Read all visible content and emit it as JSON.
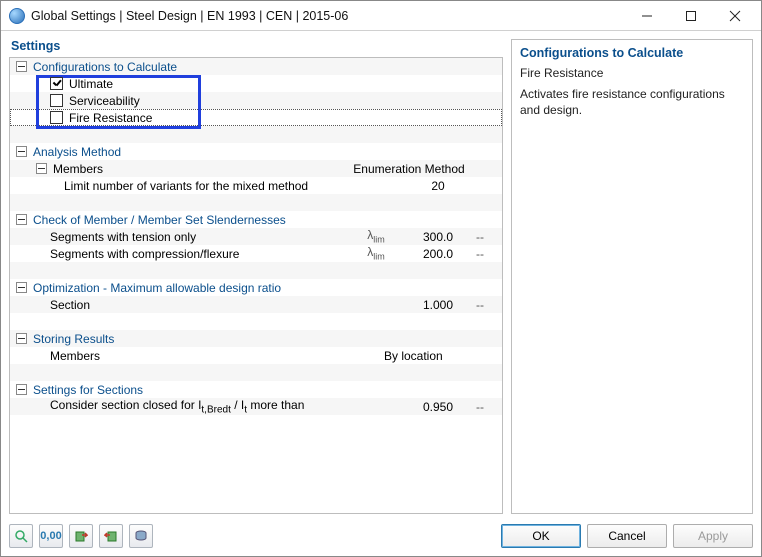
{
  "window": {
    "title": "Global Settings | Steel Design | EN 1993 | CEN | 2015-06"
  },
  "left": {
    "heading": "Settings"
  },
  "right": {
    "heading": "Configurations to Calculate",
    "subtitle": "Fire Resistance",
    "description": "Activates fire resistance configurations and design."
  },
  "tree": {
    "configs": {
      "label": "Configurations to Calculate",
      "ultimate": "Ultimate",
      "serviceability": "Serviceability",
      "fire": "Fire Resistance"
    },
    "analysis": {
      "label": "Analysis Method",
      "members": "Members",
      "members_hdr": "Enumeration Method",
      "limit_variants": "Limit number of variants for the mixed method",
      "limit_variants_val": "20"
    },
    "slender": {
      "label": "Check of Member / Member Set Slendernesses",
      "tension": "Segments with tension only",
      "tension_val": "300.0",
      "compr": "Segments with compression/flexure",
      "compr_val": "200.0",
      "symbol": "λlim",
      "unit": "--"
    },
    "opt": {
      "label": "Optimization - Maximum allowable design ratio",
      "section": "Section",
      "section_val": "1.000",
      "unit": "--"
    },
    "storing": {
      "label": "Storing Results",
      "members": "Members",
      "members_val": "By location"
    },
    "sections": {
      "label": "Settings for Sections",
      "closed": "Consider section closed for It,Bredt / It more than",
      "closed_val": "0.950",
      "unit": "--"
    }
  },
  "footer": {
    "ok": "OK",
    "cancel": "Cancel",
    "apply": "Apply"
  }
}
